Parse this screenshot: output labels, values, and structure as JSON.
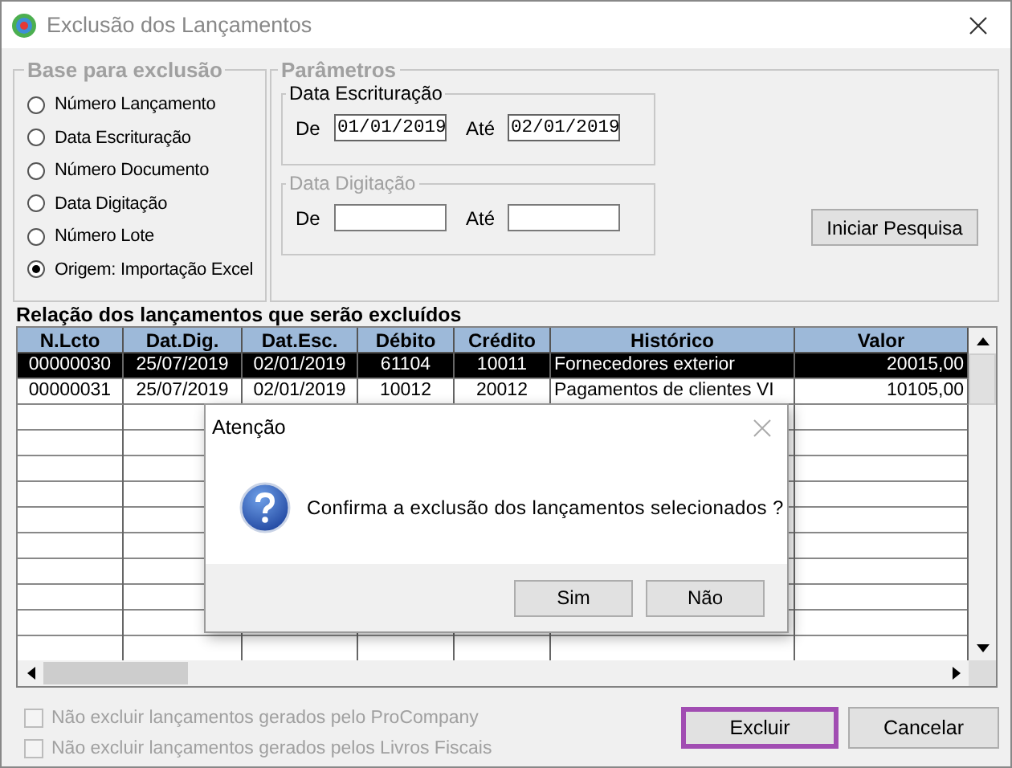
{
  "window": {
    "title": "Exclusão dos Lançamentos"
  },
  "base": {
    "title": "Base para exclusão",
    "options": [
      {
        "label": "Número Lançamento",
        "selected": false
      },
      {
        "label": "Data Escrituração",
        "selected": false
      },
      {
        "label": "Número Documento",
        "selected": false
      },
      {
        "label": "Data Digitação",
        "selected": false
      },
      {
        "label": "Número Lote",
        "selected": false
      },
      {
        "label": "Origem: Importação Excel",
        "selected": true
      }
    ]
  },
  "parameters": {
    "title": "Parâmetros",
    "groups": [
      {
        "title": "Data Escrituração",
        "disabled": false,
        "from_label": "De",
        "from_value": "01/01/2019",
        "to_label": "Até",
        "to_value": "02/01/2019"
      },
      {
        "title": "Data Digitação",
        "disabled": true,
        "from_label": "De",
        "to_label": "Até"
      }
    ],
    "search_button": "Iniciar Pesquisa"
  },
  "table": {
    "title": "Relação dos lançamentos que serão excluídos",
    "columns": [
      {
        "label": "N.Lcto"
      },
      {
        "label": "Dat.Dig."
      },
      {
        "label": "Dat.Esc."
      },
      {
        "label": "Débito"
      },
      {
        "label": "Crédito"
      },
      {
        "label": "Histórico"
      },
      {
        "label": "Valor"
      }
    ],
    "rows": [
      {
        "cells": [
          "00000030",
          "25/07/2019",
          "02/01/2019",
          "61104",
          "10011",
          "Fornecedores exterior",
          "20015,00"
        ],
        "selected": true
      },
      {
        "cells": [
          "00000031",
          "25/07/2019",
          "02/01/2019",
          "10012",
          "20012",
          "Pagamentos de clientes VI",
          "10105,00"
        ],
        "selected": false
      }
    ]
  },
  "options": [
    {
      "label": "Não excluir lançamentos gerados pelo ProCompany",
      "checked": false,
      "disabled": true
    },
    {
      "label": "Não excluir lançamentos gerados pelos Livros Fiscais",
      "checked": false,
      "disabled": true
    }
  ],
  "buttons": [
    {
      "label": "Excluir",
      "focused": true
    },
    {
      "label": "Cancelar",
      "focused": false
    }
  ],
  "dialog": {
    "title": "Atenção",
    "message": "Confirma a exclusão dos lançamentos selecionados ?",
    "buttons": [
      "Sim",
      "Não"
    ]
  }
}
